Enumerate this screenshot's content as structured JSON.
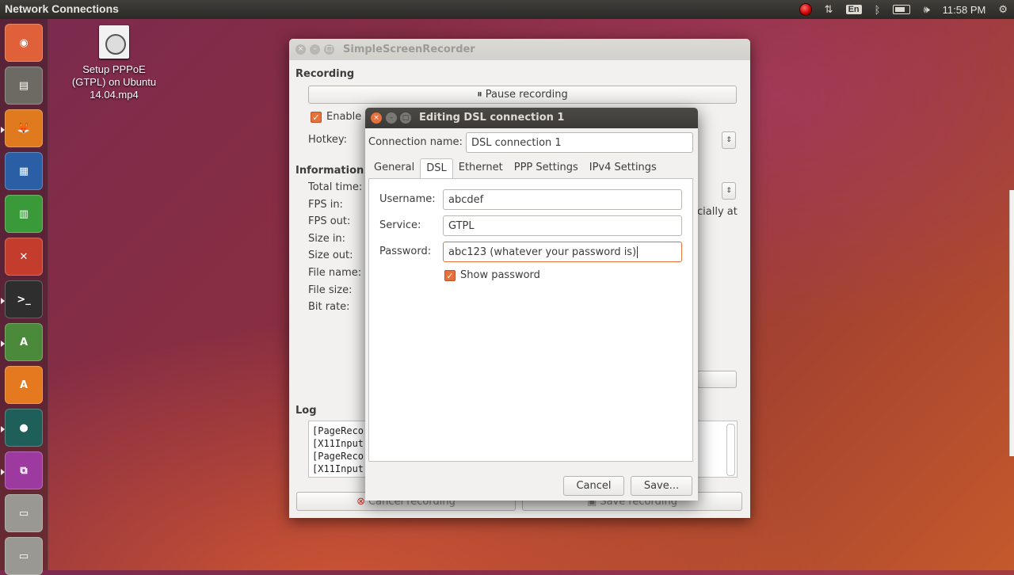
{
  "top_panel": {
    "title": "Network Connections",
    "lang": "En",
    "clock": "11:58 PM"
  },
  "desktop": {
    "file_label_1": "Setup PPPoE",
    "file_label_2": "(GTPL) on Ubuntu",
    "file_label_3": "14.04.mp4"
  },
  "ssr": {
    "title": "SimpleScreenRecorder",
    "recording_section": "Recording",
    "pause_button": "Pause recording",
    "enable_label": "Enable",
    "hotkey_label": "Hotkey:",
    "information_section": "Information",
    "info_labels": [
      "Total time:",
      "FPS in:",
      "FPS out:",
      "Size in:",
      "Size out:",
      "File name:",
      "File size:",
      "Bit rate:"
    ],
    "partial_text": "cially at",
    "log_section": "Log",
    "log_lines": [
      "[PageReco",
      "[X11Input::",
      "[PageReco",
      "[X11Input::"
    ],
    "cancel_button": "Cancel recording",
    "save_button": "Save recording"
  },
  "dialog": {
    "title": "Editing DSL connection 1",
    "connection_name_label": "Connection name:",
    "connection_name_value": "DSL connection 1",
    "tabs": [
      "General",
      "DSL",
      "Ethernet",
      "PPP Settings",
      "IPv4 Settings"
    ],
    "active_tab": "DSL",
    "username_label": "Username:",
    "username_value": "abcdef",
    "service_label": "Service:",
    "service_value": "GTPL",
    "password_label": "Password:",
    "password_value": "abc123 (whatever your password is)",
    "show_password_label": "Show password",
    "show_password_checked": true,
    "cancel_button": "Cancel",
    "save_button": "Save..."
  },
  "colors": {
    "accent": "#e8703a",
    "panel": "#2b2a27",
    "window_bg": "#f2f1f0"
  }
}
